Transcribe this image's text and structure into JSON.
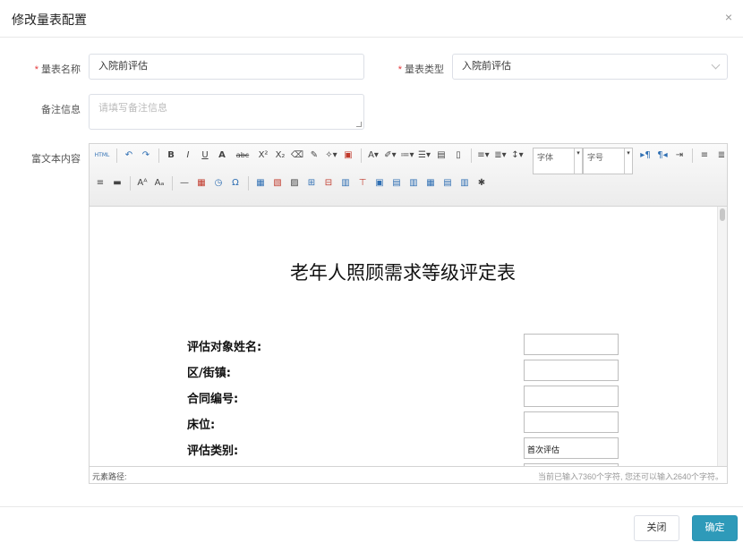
{
  "dialog": {
    "title": "修改量表配置",
    "close_glyph": "×"
  },
  "form": {
    "name_label": "量表名称",
    "name_value": "入院前评估",
    "type_label": "量表类型",
    "type_value": "入院前评估",
    "remark_label": "备注信息",
    "remark_placeholder": "请填写备注信息",
    "rich_label": "富文本内容",
    "required_mark": "*"
  },
  "toolbar": {
    "row1": [
      {
        "name": "html-source-icon",
        "glyph": "HTML"
      },
      {
        "sep": true
      },
      {
        "name": "undo-icon",
        "glyph": "↶"
      },
      {
        "name": "redo-icon",
        "glyph": "↷"
      },
      {
        "sep": true
      },
      {
        "name": "bold-icon",
        "glyph": "B"
      },
      {
        "name": "italic-icon",
        "glyph": "I"
      },
      {
        "name": "underline-icon",
        "glyph": "U"
      },
      {
        "name": "font-border-icon",
        "glyph": "A"
      },
      {
        "name": "strikethrough-icon",
        "glyph": "abc"
      },
      {
        "name": "superscript-icon",
        "glyph": "X²"
      },
      {
        "name": "subscript-icon",
        "glyph": "X₂"
      },
      {
        "name": "eraser-icon",
        "glyph": "⌫"
      },
      {
        "name": "format-brush-icon",
        "glyph": "✎"
      },
      {
        "name": "auto-format-icon",
        "glyph": "✧▾"
      },
      {
        "name": "paste-plain-icon",
        "glyph": "▣"
      },
      {
        "sep": true
      },
      {
        "name": "font-color-icon",
        "glyph": "A▾"
      },
      {
        "name": "highlight-color-icon",
        "glyph": "✐▾"
      },
      {
        "name": "ordered-list-icon",
        "glyph": "≔▾"
      },
      {
        "name": "unordered-list-icon",
        "glyph": "☰▾"
      },
      {
        "name": "select-all-icon",
        "glyph": "▤"
      },
      {
        "name": "clear-doc-icon",
        "glyph": "▯"
      },
      {
        "sep": true
      },
      {
        "name": "row-spacing-top-icon",
        "glyph": "≡▾"
      },
      {
        "name": "row-spacing-bottom-icon",
        "glyph": "≣▾"
      },
      {
        "name": "line-height-icon",
        "glyph": "↕▾"
      }
    ],
    "font_family_label": "字体",
    "font_size_label": "字号",
    "row1_tail": [
      {
        "name": "ltr-icon",
        "glyph": "▸¶"
      },
      {
        "name": "rtl-icon",
        "glyph": "¶◂"
      },
      {
        "name": "indent-icon",
        "glyph": "⇥"
      },
      {
        "sep": true
      },
      {
        "name": "align-left-icon",
        "glyph": "≡"
      },
      {
        "name": "align-center-icon",
        "glyph": "≣"
      }
    ],
    "row2": [
      {
        "name": "align-right-icon",
        "glyph": "≡"
      },
      {
        "name": "align-justify-icon",
        "glyph": "▬"
      },
      {
        "sep": true
      },
      {
        "name": "uppercase-icon",
        "glyph": "Aᴬ"
      },
      {
        "name": "lowercase-icon",
        "glyph": "Aₐ"
      },
      {
        "sep": true
      },
      {
        "name": "horizontal-rule-icon",
        "glyph": "—"
      },
      {
        "name": "date-icon",
        "glyph": "▦"
      },
      {
        "name": "time-icon",
        "glyph": "◷"
      },
      {
        "name": "special-char-icon",
        "glyph": "Ω"
      },
      {
        "sep": true
      },
      {
        "name": "insert-table-icon",
        "glyph": "▦"
      },
      {
        "name": "delete-table-icon",
        "glyph": "▧"
      },
      {
        "name": "insert-paragraph-before-table-icon",
        "glyph": "▨"
      },
      {
        "name": "insert-row-icon",
        "glyph": "⊞"
      },
      {
        "name": "delete-row-icon",
        "glyph": "⊟"
      },
      {
        "name": "insert-col-icon",
        "glyph": "▥"
      },
      {
        "name": "delete-col-icon",
        "glyph": "⊤"
      },
      {
        "name": "merge-cells-icon",
        "glyph": "▣"
      },
      {
        "name": "merge-right-icon",
        "glyph": "▤"
      },
      {
        "name": "merge-down-icon",
        "glyph": "▥"
      },
      {
        "name": "split-cells-icon",
        "glyph": "▦"
      },
      {
        "name": "split-rows-icon",
        "glyph": "▤"
      },
      {
        "name": "split-cols-icon",
        "glyph": "▥"
      },
      {
        "name": "print-icon",
        "glyph": "✱"
      }
    ]
  },
  "document": {
    "title": "老年人照顾需求等级评定表",
    "fields": [
      {
        "label": "评估对象姓名:",
        "value": ""
      },
      {
        "label": "区/街镇:",
        "value": ""
      },
      {
        "label": "合同编号:",
        "value": ""
      },
      {
        "label": "床位:",
        "value": ""
      },
      {
        "label": "评估类别:",
        "value": "首次评估"
      }
    ]
  },
  "statusbar": {
    "path_label": "元素路径:",
    "word_count": "当前已输入7360个字符, 您还可以输入2640个字符。"
  },
  "footer": {
    "close_label": "关闭",
    "ok_label": "确定"
  },
  "colors": {
    "primary": "#2e9ab9",
    "required": "#e4393c"
  }
}
